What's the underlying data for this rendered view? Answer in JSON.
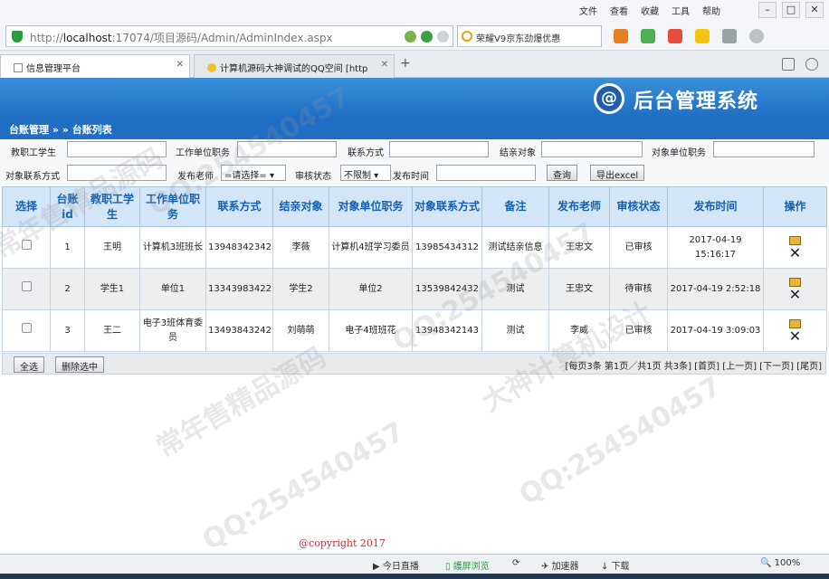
{
  "browser": {
    "menu": [
      "文件",
      "查看",
      "收藏",
      "工具",
      "帮助"
    ],
    "url_prefix": "http://",
    "url_host": "localhost",
    "url_rest": ":17074/项目源码/Admin/AdminIndex.aspx",
    "search_text": "荣耀V9京东劲爆优惠",
    "tabs": [
      {
        "title": "信息管理平台"
      },
      {
        "title": "计算机源码大神调试的QQ空间 [http"
      }
    ]
  },
  "app": {
    "banner_title": "后台管理系统",
    "logo_glyph": "@",
    "breadcrumb": "台账管理 » » 台账列表"
  },
  "filters": {
    "teacher_student": "教职工学生",
    "work_unit_duty": "工作单位职务",
    "contact": "联系方式",
    "pair_target": "结亲对象",
    "target_unit_duty": "对象单位职务",
    "target_contact": "对象联系方式",
    "publish_teacher": "发布老师",
    "teacher_select": "=请选择=",
    "review_status": "审核状态",
    "review_select": "不限制",
    "publish_time": "发布时间",
    "query_btn": "查询",
    "export_btn": "导出excel"
  },
  "table": {
    "headers": [
      "选择",
      "台账id",
      "教职工学生",
      "工作单位职务",
      "联系方式",
      "结亲对象",
      "对象单位职务",
      "对象联系方式",
      "备注",
      "发布老师",
      "审核状态",
      "发布时间",
      "操作"
    ],
    "rows": [
      {
        "id": "1",
        "person": "王明",
        "unit": "计算机3班班长",
        "phone": "13948342342",
        "target": "李薇",
        "target_unit": "计算机4班学习委员",
        "target_phone": "13985434312",
        "note": "测试结亲信息",
        "teacher": "王忠文",
        "status": "已审核",
        "time": "2017-04-19 15:16:17"
      },
      {
        "id": "2",
        "person": "学生1",
        "unit": "单位1",
        "phone": "13343983422",
        "target": "学生2",
        "target_unit": "单位2",
        "target_phone": "13539842432",
        "note": "测试",
        "teacher": "王忠文",
        "status": "待审核",
        "time": "2017-04-19 2:52:18"
      },
      {
        "id": "3",
        "person": "王二",
        "unit": "电子3班体育委员",
        "phone": "13493843242",
        "target": "刘萌萌",
        "target_unit": "电子4班班花",
        "target_phone": "13948342143",
        "note": "测试",
        "teacher": "李威",
        "status": "已审核",
        "time": "2017-04-19 3:09:03"
      }
    ]
  },
  "footer": {
    "select_all": "全选",
    "delete_selected": "删除选中",
    "pager": "[每页3条 第1页／共1页 共3条] [首页] [上一页] [下一页] [尾页]"
  },
  "copyright": "@copyright 2017",
  "statusbar": {
    "live": "今日直播",
    "eye": "護屏浏览",
    "accel": "加速器",
    "download": "下载",
    "zoom": "100%"
  },
  "watermarks": [
    "常年售精品源码",
    "QQ:254540457",
    "大神计算机设计"
  ]
}
